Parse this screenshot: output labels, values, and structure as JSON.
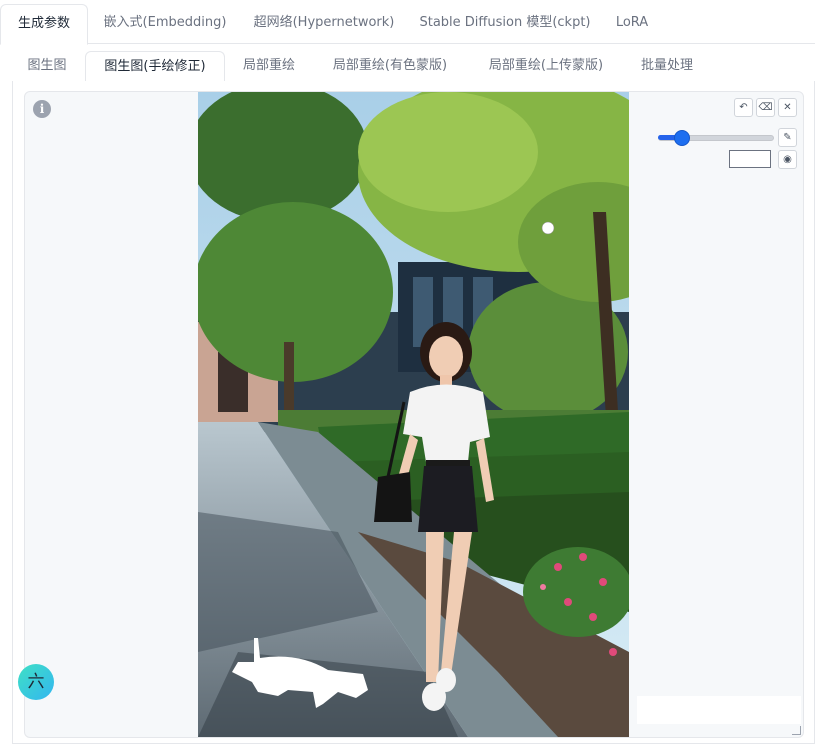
{
  "tabs": [
    {
      "label": "生成参数",
      "active": true
    },
    {
      "label": "嵌入式(Embedding)",
      "active": false
    },
    {
      "label": "超网络(Hypernetwork)",
      "active": false
    },
    {
      "label": "Stable Diffusion 模型(ckpt)",
      "active": false
    },
    {
      "label": "LoRA",
      "active": false
    }
  ],
  "subtabs": [
    {
      "label": "图生图",
      "active": false
    },
    {
      "label": "图生图(手绘修正)",
      "active": true
    },
    {
      "label": "局部重绘",
      "active": false
    },
    {
      "label": "局部重绘(有色蒙版)",
      "active": false
    },
    {
      "label": "局部重绘(上传蒙版)",
      "active": false
    },
    {
      "label": "批量处理",
      "active": false
    }
  ],
  "canvas": {
    "info_icon": "info-icon",
    "info_glyph": "i",
    "tools": {
      "undo_icon": "↶",
      "eraser_icon": "⌫",
      "close_icon": "✕",
      "brush_icon": "✎",
      "color_picker_icon": "◉"
    },
    "brush_size": 0.2,
    "brush_color": "#ffffff",
    "accent_color": "#2563eb"
  },
  "float_badge": {
    "glyph": "六"
  }
}
